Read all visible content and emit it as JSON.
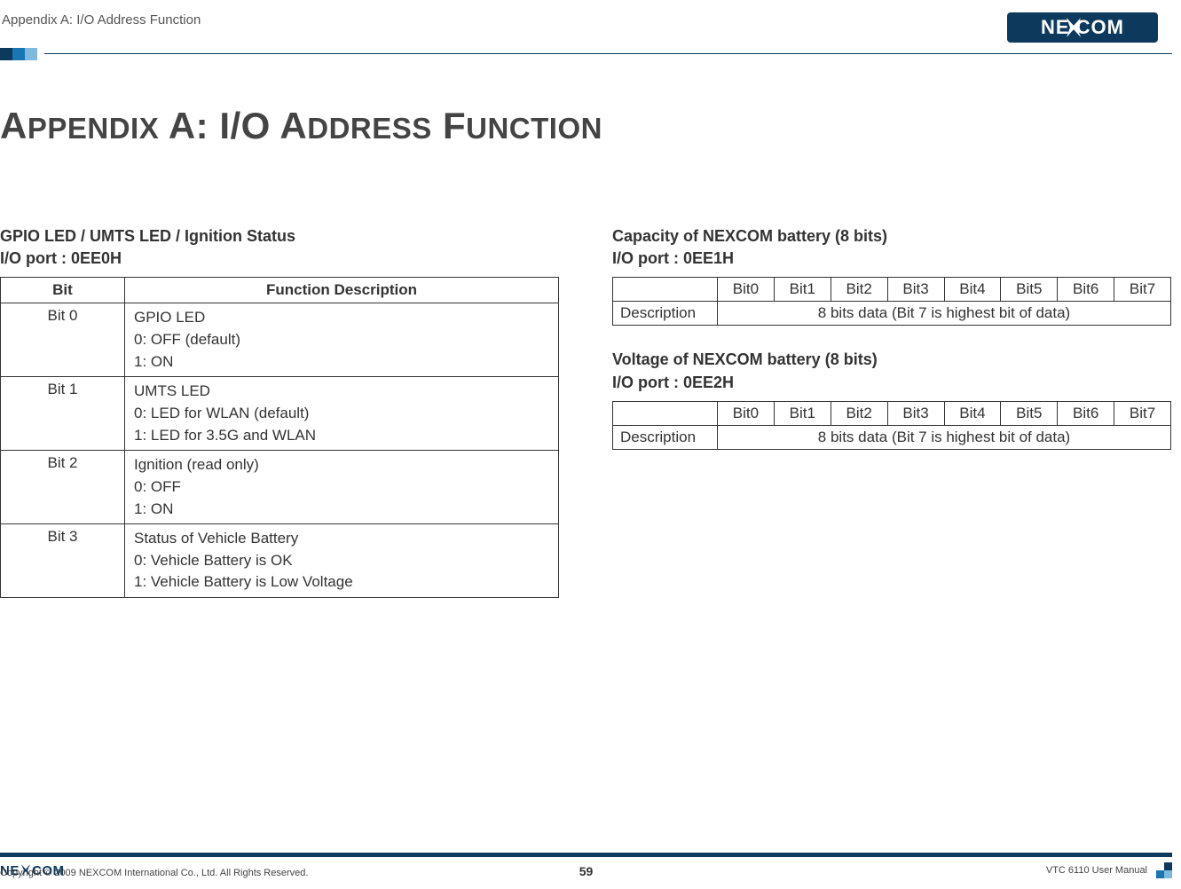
{
  "header": {
    "section_title": "Appendix A: I/O Address Function",
    "logo_text": "NEXCOM"
  },
  "page_title": "Appendix A: I/O Address Function",
  "left": {
    "heading_line1": "GPIO LED / UMTS LED / Ignition Status",
    "heading_line2": "I/O port : 0EE0H",
    "table": {
      "col_bit": "Bit",
      "col_desc": "Function Description",
      "rows": [
        {
          "bit": "Bit 0",
          "desc": "GPIO LED\n0: OFF (default)\n1: ON"
        },
        {
          "bit": "Bit 1",
          "desc": "UMTS LED\n0: LED for WLAN (default)\n1: LED for 3.5G and WLAN"
        },
        {
          "bit": "Bit 2",
          "desc": "Ignition (read only)\n0: OFF\n1: ON"
        },
        {
          "bit": "Bit 3",
          "desc": "Status of Vehicle Battery\n0: Vehicle Battery is OK\n1: Vehicle Battery is Low Voltage"
        }
      ]
    }
  },
  "right": {
    "section1": {
      "heading_line1": "Capacity of NEXCOM battery (8 bits)",
      "heading_line2": "I/O port : 0EE1H",
      "bits": [
        "Bit0",
        "Bit1",
        "Bit2",
        "Bit3",
        "Bit4",
        "Bit5",
        "Bit6",
        "Bit7"
      ],
      "row_label": "Description",
      "row_value": "8 bits data (Bit 7 is highest bit of data)"
    },
    "section2": {
      "heading_line1": "Voltage of NEXCOM battery (8 bits)",
      "heading_line2": "I/O port : 0EE2H",
      "bits": [
        "Bit0",
        "Bit1",
        "Bit2",
        "Bit3",
        "Bit4",
        "Bit5",
        "Bit6",
        "Bit7"
      ],
      "row_label": "Description",
      "row_value": "8 bits data (Bit 7 is highest bit of data)"
    }
  },
  "footer": {
    "copyright": "Copyright © 2009 NEXCOM International Co., Ltd. All Rights Reserved.",
    "page_number": "59",
    "manual": "VTC 6110 User Manual",
    "logo_text": "NEXCOM"
  }
}
